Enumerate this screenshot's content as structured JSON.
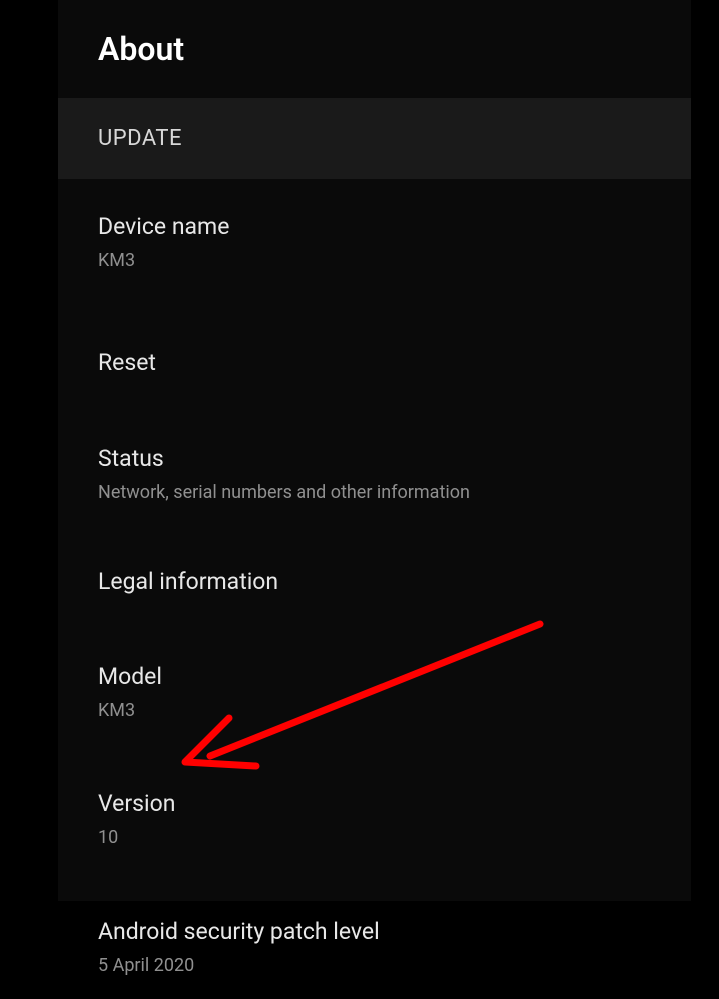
{
  "header": {
    "title": "About"
  },
  "section": {
    "header": "UPDATE"
  },
  "items": {
    "device_name": {
      "title": "Device name",
      "value": "KM3"
    },
    "reset": {
      "title": "Reset"
    },
    "status": {
      "title": "Status",
      "subtitle": "Network, serial numbers and other information"
    },
    "legal": {
      "title": "Legal information"
    },
    "model": {
      "title": "Model",
      "value": "KM3"
    },
    "version": {
      "title": "Version",
      "value": "10"
    },
    "security_patch": {
      "title": "Android security patch level",
      "value": "5 April 2020"
    }
  },
  "annotation": {
    "color": "#ff0000"
  }
}
